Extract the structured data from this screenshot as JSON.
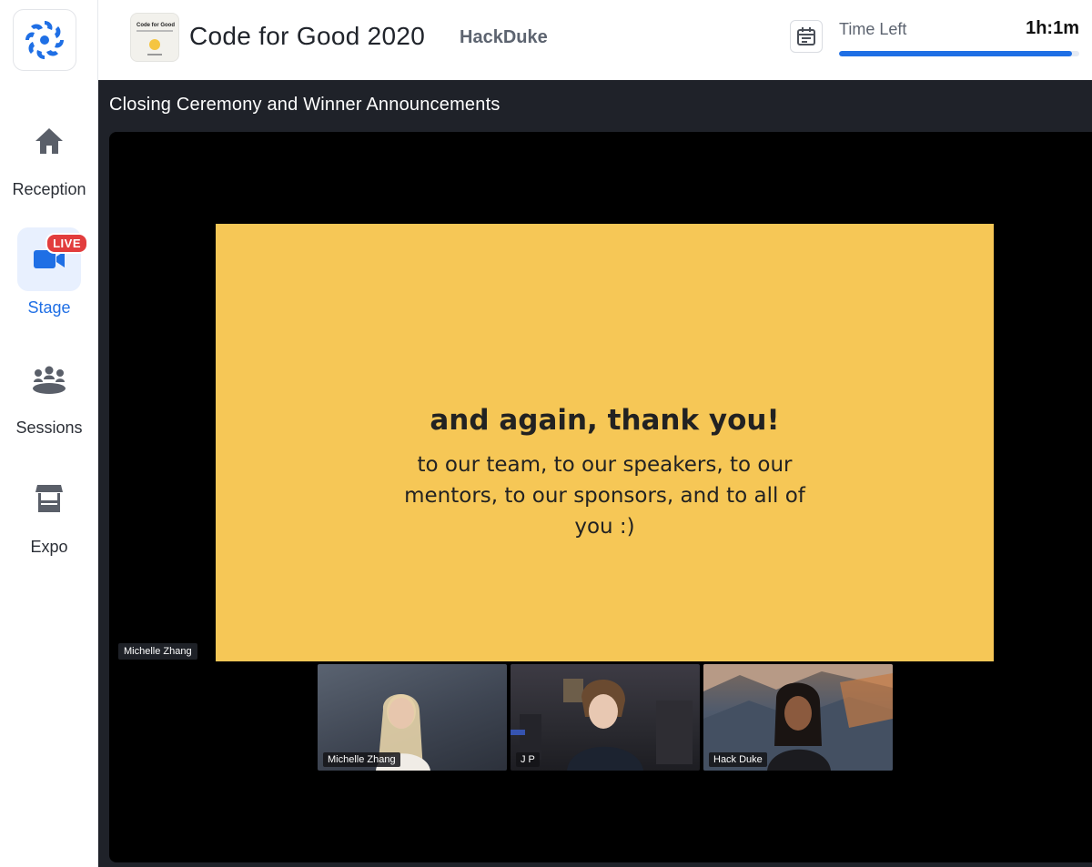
{
  "sidebar": {
    "items": [
      {
        "label": "Reception",
        "icon": "home-icon"
      },
      {
        "label": "Stage",
        "icon": "video-camera-icon",
        "badge": "LIVE",
        "active": true
      },
      {
        "label": "Sessions",
        "icon": "people-group-icon"
      },
      {
        "label": "Expo",
        "icon": "booth-icon"
      }
    ]
  },
  "header": {
    "event_title": "Code for Good 2020",
    "org_name": "HackDuke",
    "thumb_title": "Code for Good",
    "time_label": "Time Left",
    "time_value": "1h:1m",
    "time_progress": 0.97
  },
  "stage": {
    "title": "Closing Ceremony and Winner Announcements",
    "active_speaker": "Michelle Zhang",
    "slide": {
      "heading": "and again, thank you!",
      "body": "to our team, to our speakers, to our mentors, to our sponsors, and to all of you :)"
    },
    "participants": [
      "Michelle Zhang",
      "J P",
      "Hack Duke"
    ]
  },
  "colors": {
    "accent": "#1f6fe5",
    "live": "#e23d3d",
    "slide_bg": "#f6c756",
    "stage_bg": "#1f2229"
  }
}
